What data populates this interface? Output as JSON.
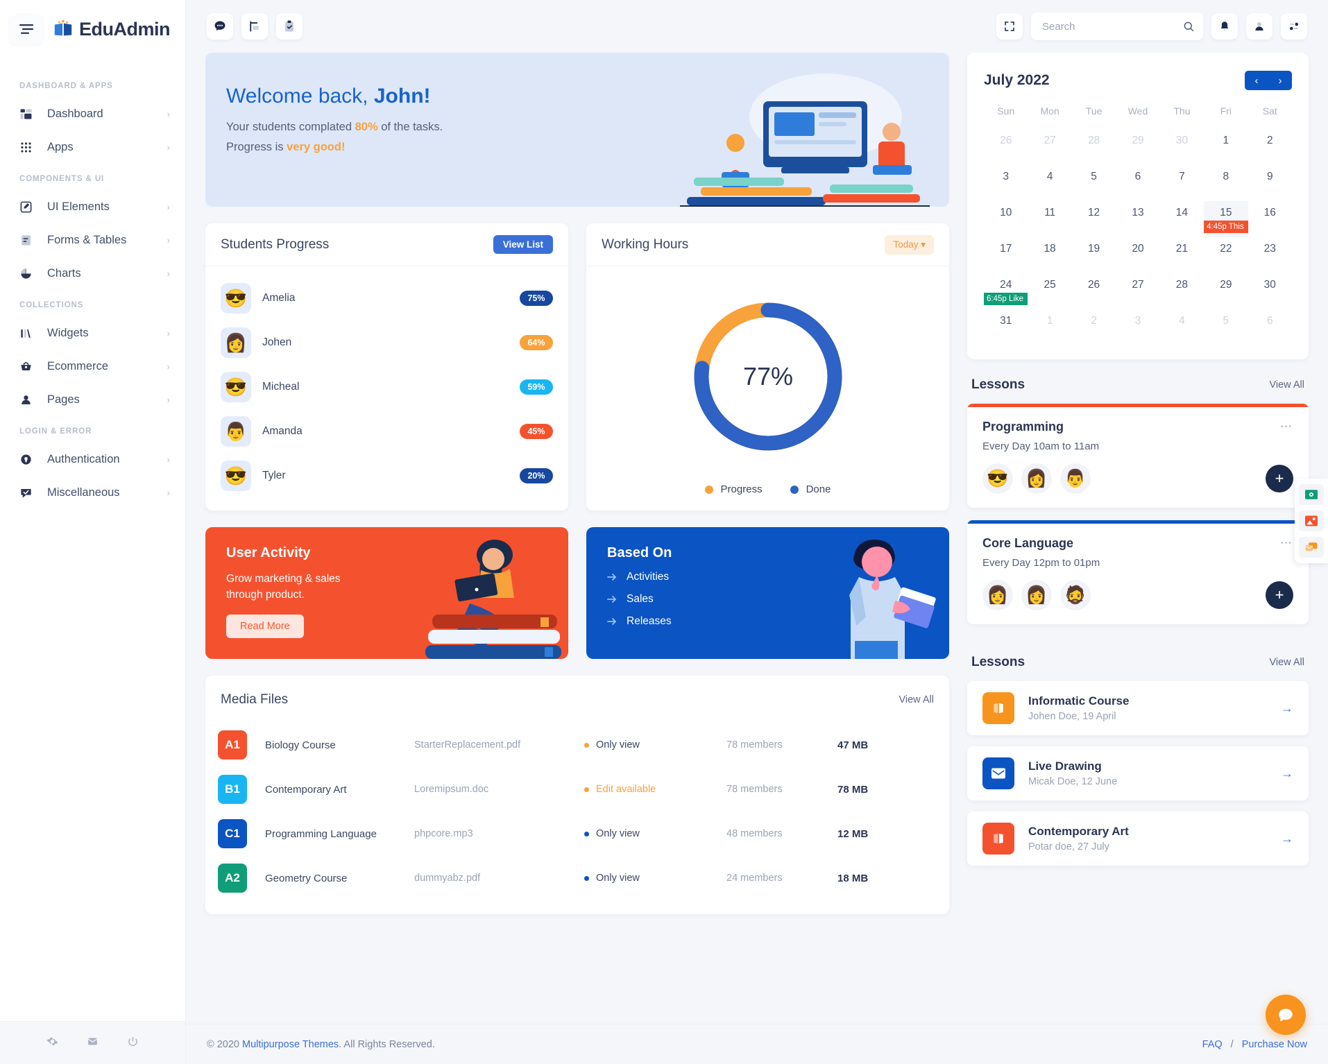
{
  "brand": {
    "name_1": "Edu",
    "name_2": "Admin",
    "logo_icon": "book-logo-icon"
  },
  "sidebar": {
    "sections": [
      {
        "label": "DASHBOARD & APPS",
        "items": [
          {
            "label": "Dashboard",
            "icon": "grid-icon",
            "arrow": "›"
          },
          {
            "label": "Apps",
            "icon": "apps-dots-icon",
            "arrow": "›"
          }
        ]
      },
      {
        "label": "COMPONENTS & UI",
        "items": [
          {
            "label": "UI Elements",
            "icon": "pencil-square-icon",
            "arrow": "›"
          },
          {
            "label": "Forms & Tables",
            "icon": "document-icon",
            "arrow": "›"
          },
          {
            "label": "Charts",
            "icon": "pie-chart-icon",
            "arrow": "›"
          }
        ]
      },
      {
        "label": "COLLECTIONS",
        "items": [
          {
            "label": "Widgets",
            "icon": "bars-icon",
            "arrow": "›"
          },
          {
            "label": "Ecommerce",
            "icon": "basket-icon",
            "arrow": "›"
          },
          {
            "label": "Pages",
            "icon": "user-icon",
            "arrow": "›"
          }
        ]
      },
      {
        "label": "LOGIN & ERROR",
        "items": [
          {
            "label": "Authentication",
            "icon": "lock-circle-icon",
            "arrow": "›"
          },
          {
            "label": "Miscellaneous",
            "icon": "chat-check-icon",
            "arrow": "›"
          }
        ]
      }
    ],
    "footer_icons": [
      "gear-icon",
      "mail-icon",
      "power-icon"
    ]
  },
  "topbar": {
    "left_buttons": [
      {
        "icon": "chat-bubble-icon"
      },
      {
        "icon": "task-board-icon"
      },
      {
        "icon": "clipboard-check-icon"
      }
    ],
    "fullscreen_icon": "fullscreen-icon",
    "search": {
      "placeholder": "Search",
      "value": "",
      "icon": "search-icon"
    },
    "right_buttons": [
      {
        "icon": "bell-icon"
      },
      {
        "icon": "user-avatar-icon"
      },
      {
        "icon": "settings-sliders-icon"
      }
    ]
  },
  "welcome": {
    "title_prefix": "Welcome back, ",
    "title_name": "John!",
    "line1_a": "Your students complated ",
    "line1_hi": "80%",
    "line1_b": " of the tasks.",
    "line2_a": "Progress is ",
    "line2_hi": "very good!"
  },
  "students_progress": {
    "title": "Students Progress",
    "action": "View List",
    "rows": [
      {
        "name": "Amelia",
        "percent": "75%",
        "value": 75,
        "color": "#17479e",
        "avatar": "😎"
      },
      {
        "name": "Johen",
        "percent": "64%",
        "value": 64,
        "color": "#f7a23b",
        "avatar": "👩"
      },
      {
        "name": "Micheal",
        "percent": "59%",
        "value": 59,
        "color": "#19b5f2",
        "avatar": "😎"
      },
      {
        "name": "Amanda",
        "percent": "45%",
        "value": 45,
        "color": "#f4522f",
        "avatar": "👨"
      },
      {
        "name": "Tyler",
        "percent": "20%",
        "value": 20,
        "color": "#17479e",
        "avatar": "😎"
      }
    ]
  },
  "working_hours": {
    "title": "Working Hours",
    "filter": "Today",
    "center_label": "77%"
  },
  "chart_data": {
    "type": "pie",
    "title": "Working Hours",
    "labels": [
      "Progress",
      "Done"
    ],
    "values": [
      23,
      77
    ],
    "colors": [
      "#f7a23b",
      "#2e62c4"
    ],
    "center_text": "77%",
    "donut": true,
    "legend_position": "bottom"
  },
  "user_activity": {
    "title": "User Activity",
    "line1": "Grow marketing & sales",
    "line2": "through product.",
    "button": "Read More",
    "bg": "#f4522f"
  },
  "based_on": {
    "title": "Based On",
    "items": [
      "Activities",
      "Sales",
      "Releases"
    ],
    "bg": "#0b54c4"
  },
  "media_files": {
    "title": "Media Files",
    "view_all": "View All",
    "rows": [
      {
        "tag": "A1",
        "tag_color": "#f4522f",
        "name": "Biology Course",
        "file": "StarterReplacement.pdf",
        "permission": "Only view",
        "perm_color": "#f7a23b",
        "perm_text_color": "#3b4761",
        "members": "78 members",
        "size": "47 MB"
      },
      {
        "tag": "B1",
        "tag_color": "#19b5f2",
        "name": "Contemporary Art",
        "file": "Loremipsum.doc",
        "permission": "Edit available",
        "perm_color": "#f7a23b",
        "perm_text_color": "#f7a23b",
        "members": "78 members",
        "size": "78 MB"
      },
      {
        "tag": "C1",
        "tag_color": "#0b54c4",
        "name": "Programming Language",
        "file": "phpcore.mp3",
        "permission": "Only view",
        "perm_color": "#0b54c4",
        "perm_text_color": "#3b4761",
        "members": "48 members",
        "size": "12 MB"
      },
      {
        "tag": "A2",
        "tag_color": "#0f9e79",
        "name": "Geometry Course",
        "file": "dummyabz.pdf",
        "permission": "Only view",
        "perm_color": "#0b54c4",
        "perm_text_color": "#3b4761",
        "members": "24 members",
        "size": "18 MB"
      }
    ]
  },
  "calendar": {
    "month_title": "July 2022",
    "prev_icon": "chevron-left-icon",
    "next_icon": "chevron-right-icon",
    "day_names": [
      "Sun",
      "Mon",
      "Tue",
      "Wed",
      "Thu",
      "Fri",
      "Sat"
    ],
    "weeks": [
      [
        {
          "d": "26",
          "mut": true
        },
        {
          "d": "27",
          "mut": true
        },
        {
          "d": "28",
          "mut": true
        },
        {
          "d": "29",
          "mut": true
        },
        {
          "d": "30",
          "mut": true
        },
        {
          "d": "1"
        },
        {
          "d": "2"
        }
      ],
      [
        {
          "d": "3"
        },
        {
          "d": "4"
        },
        {
          "d": "5"
        },
        {
          "d": "6"
        },
        {
          "d": "7"
        },
        {
          "d": "8"
        },
        {
          "d": "9"
        }
      ],
      [
        {
          "d": "10"
        },
        {
          "d": "11"
        },
        {
          "d": "12"
        },
        {
          "d": "13"
        },
        {
          "d": "14"
        },
        {
          "d": "15",
          "sel": true,
          "event": "4:45p This",
          "event_color": "#f4522f"
        },
        {
          "d": "16"
        }
      ],
      [
        {
          "d": "17"
        },
        {
          "d": "18"
        },
        {
          "d": "19"
        },
        {
          "d": "20"
        },
        {
          "d": "21"
        },
        {
          "d": "22"
        },
        {
          "d": "23"
        }
      ],
      [
        {
          "d": "24",
          "event": "6:45p Like",
          "event_color": "#0f9e79"
        },
        {
          "d": "25"
        },
        {
          "d": "26"
        },
        {
          "d": "27"
        },
        {
          "d": "28"
        },
        {
          "d": "29"
        },
        {
          "d": "30"
        }
      ],
      [
        {
          "d": "31"
        },
        {
          "d": "1",
          "mut": true
        },
        {
          "d": "2",
          "mut": true
        },
        {
          "d": "3",
          "mut": true
        },
        {
          "d": "4",
          "mut": true
        },
        {
          "d": "5",
          "mut": true
        },
        {
          "d": "6",
          "mut": true
        }
      ]
    ]
  },
  "lessons_cards": {
    "title": "Lessons",
    "view_all": "View All",
    "items": [
      {
        "name": "Programming",
        "time": "Every Day 10am to 11am",
        "accent": "#f4522f",
        "avatars": [
          "😎",
          "👩",
          "👨"
        ],
        "menu_icon": "more-dots-icon",
        "add_label": "+"
      },
      {
        "name": "Core Language",
        "time": "Every Day 12pm to 01pm",
        "accent": "#0b54c4",
        "avatars": [
          "👩",
          "👩",
          "🧔"
        ],
        "menu_icon": "more-dots-icon",
        "add_label": "+"
      }
    ]
  },
  "lessons_list": {
    "title": "Lessons",
    "view_all": "View All",
    "items": [
      {
        "title": "Informatic Course",
        "sub": "Johen Doe, 19 April",
        "color": "#f7941e",
        "icon": "book-icon",
        "arrow_icon": "arrow-right-icon"
      },
      {
        "title": "Live Drawing",
        "sub": "Micak Doe, 12 June",
        "color": "#0b54c4",
        "icon": "envelope-icon",
        "arrow_icon": "arrow-right-icon"
      },
      {
        "title": "Contemporary Art",
        "sub": "Potar doe, 27 July",
        "color": "#f4522f",
        "icon": "book-icon",
        "arrow_icon": "arrow-right-icon"
      }
    ]
  },
  "float_tools": [
    {
      "icon": "money-icon",
      "color": "#0f9e79"
    },
    {
      "icon": "image-icon",
      "color": "#f4522f"
    },
    {
      "icon": "chat-icon",
      "color": "#f7941e"
    }
  ],
  "chat_fab": {
    "icon": "chat-bubble-icon",
    "color": "#f7931e"
  },
  "footer": {
    "copyright_pre": "© 2020 ",
    "copyright_link": "Multipurpose Themes",
    "copyright_post": ". All Rights Reserved.",
    "links": [
      "FAQ",
      "/",
      "Purchase Now"
    ]
  }
}
